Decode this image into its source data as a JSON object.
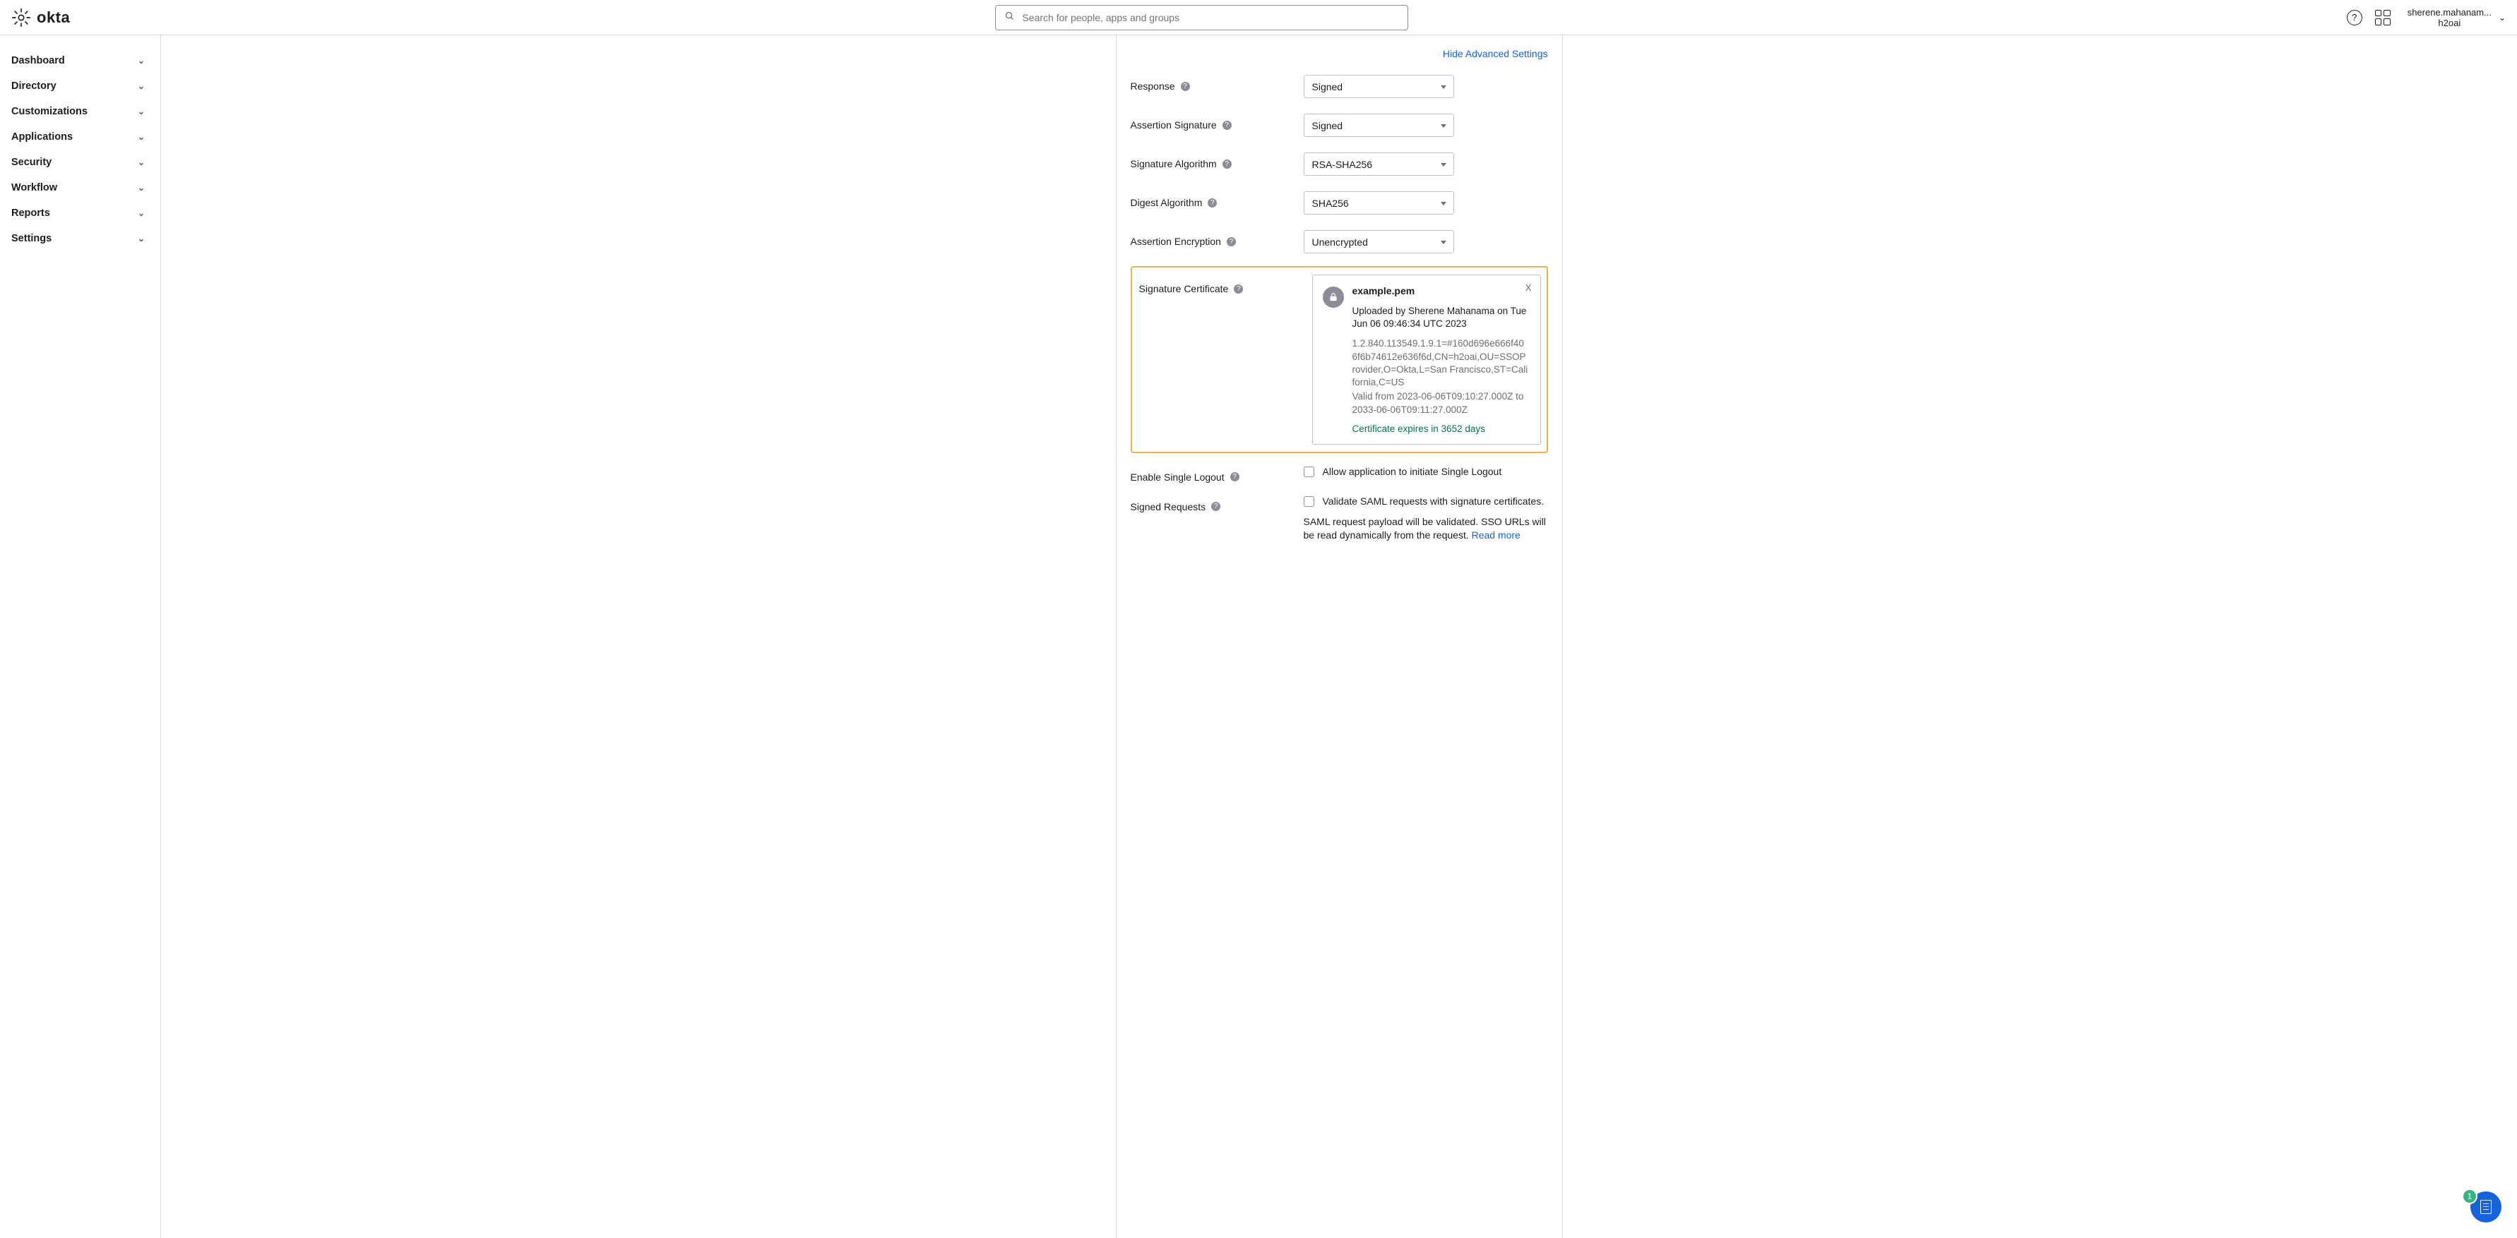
{
  "header": {
    "brand": "okta",
    "search_placeholder": "Search for people, apps and groups",
    "user_line1": "sherene.mahanam...",
    "user_line2": "h2oai"
  },
  "sidebar": {
    "items": [
      {
        "label": "Dashboard"
      },
      {
        "label": "Directory"
      },
      {
        "label": "Customizations"
      },
      {
        "label": "Applications"
      },
      {
        "label": "Security"
      },
      {
        "label": "Workflow"
      },
      {
        "label": "Reports"
      },
      {
        "label": "Settings"
      }
    ]
  },
  "form": {
    "hide_advanced": "Hide Advanced Settings",
    "rows": {
      "response": {
        "label": "Response",
        "value": "Signed"
      },
      "assertion_signature": {
        "label": "Assertion Signature",
        "value": "Signed"
      },
      "signature_algorithm": {
        "label": "Signature Algorithm",
        "value": "RSA-SHA256"
      },
      "digest_algorithm": {
        "label": "Digest Algorithm",
        "value": "SHA256"
      },
      "assertion_encryption": {
        "label": "Assertion Encryption",
        "value": "Unencrypted"
      },
      "signature_certificate": {
        "label": "Signature Certificate"
      },
      "enable_single_logout": {
        "label": "Enable Single Logout",
        "checkbox_label": "Allow application to initiate Single Logout"
      },
      "signed_requests": {
        "label": "Signed Requests",
        "checkbox_label": "Validate SAML requests with signature certificates.",
        "help_text": "SAML request payload will be validated. SSO URLs will be read dynamically from the request. ",
        "read_more": "Read more"
      }
    },
    "certificate": {
      "file_name": "example.pem",
      "uploaded_by": "Uploaded by Sherene Mahanama on Tue Jun 06 09:46:34 UTC 2023",
      "dn": "1.2.840.113549.1.9.1=#160d696e666f406f6b74612e636f6d,CN=h2oai,OU=SSOProvider,O=Okta,L=San Francisco,ST=California,C=US",
      "validity": "Valid from 2023-06-06T09:10:27.000Z to 2033-06-06T09:11:27.000Z",
      "expires": "Certificate expires in 3652 days",
      "close": "X"
    }
  },
  "fab": {
    "badge": "1"
  }
}
